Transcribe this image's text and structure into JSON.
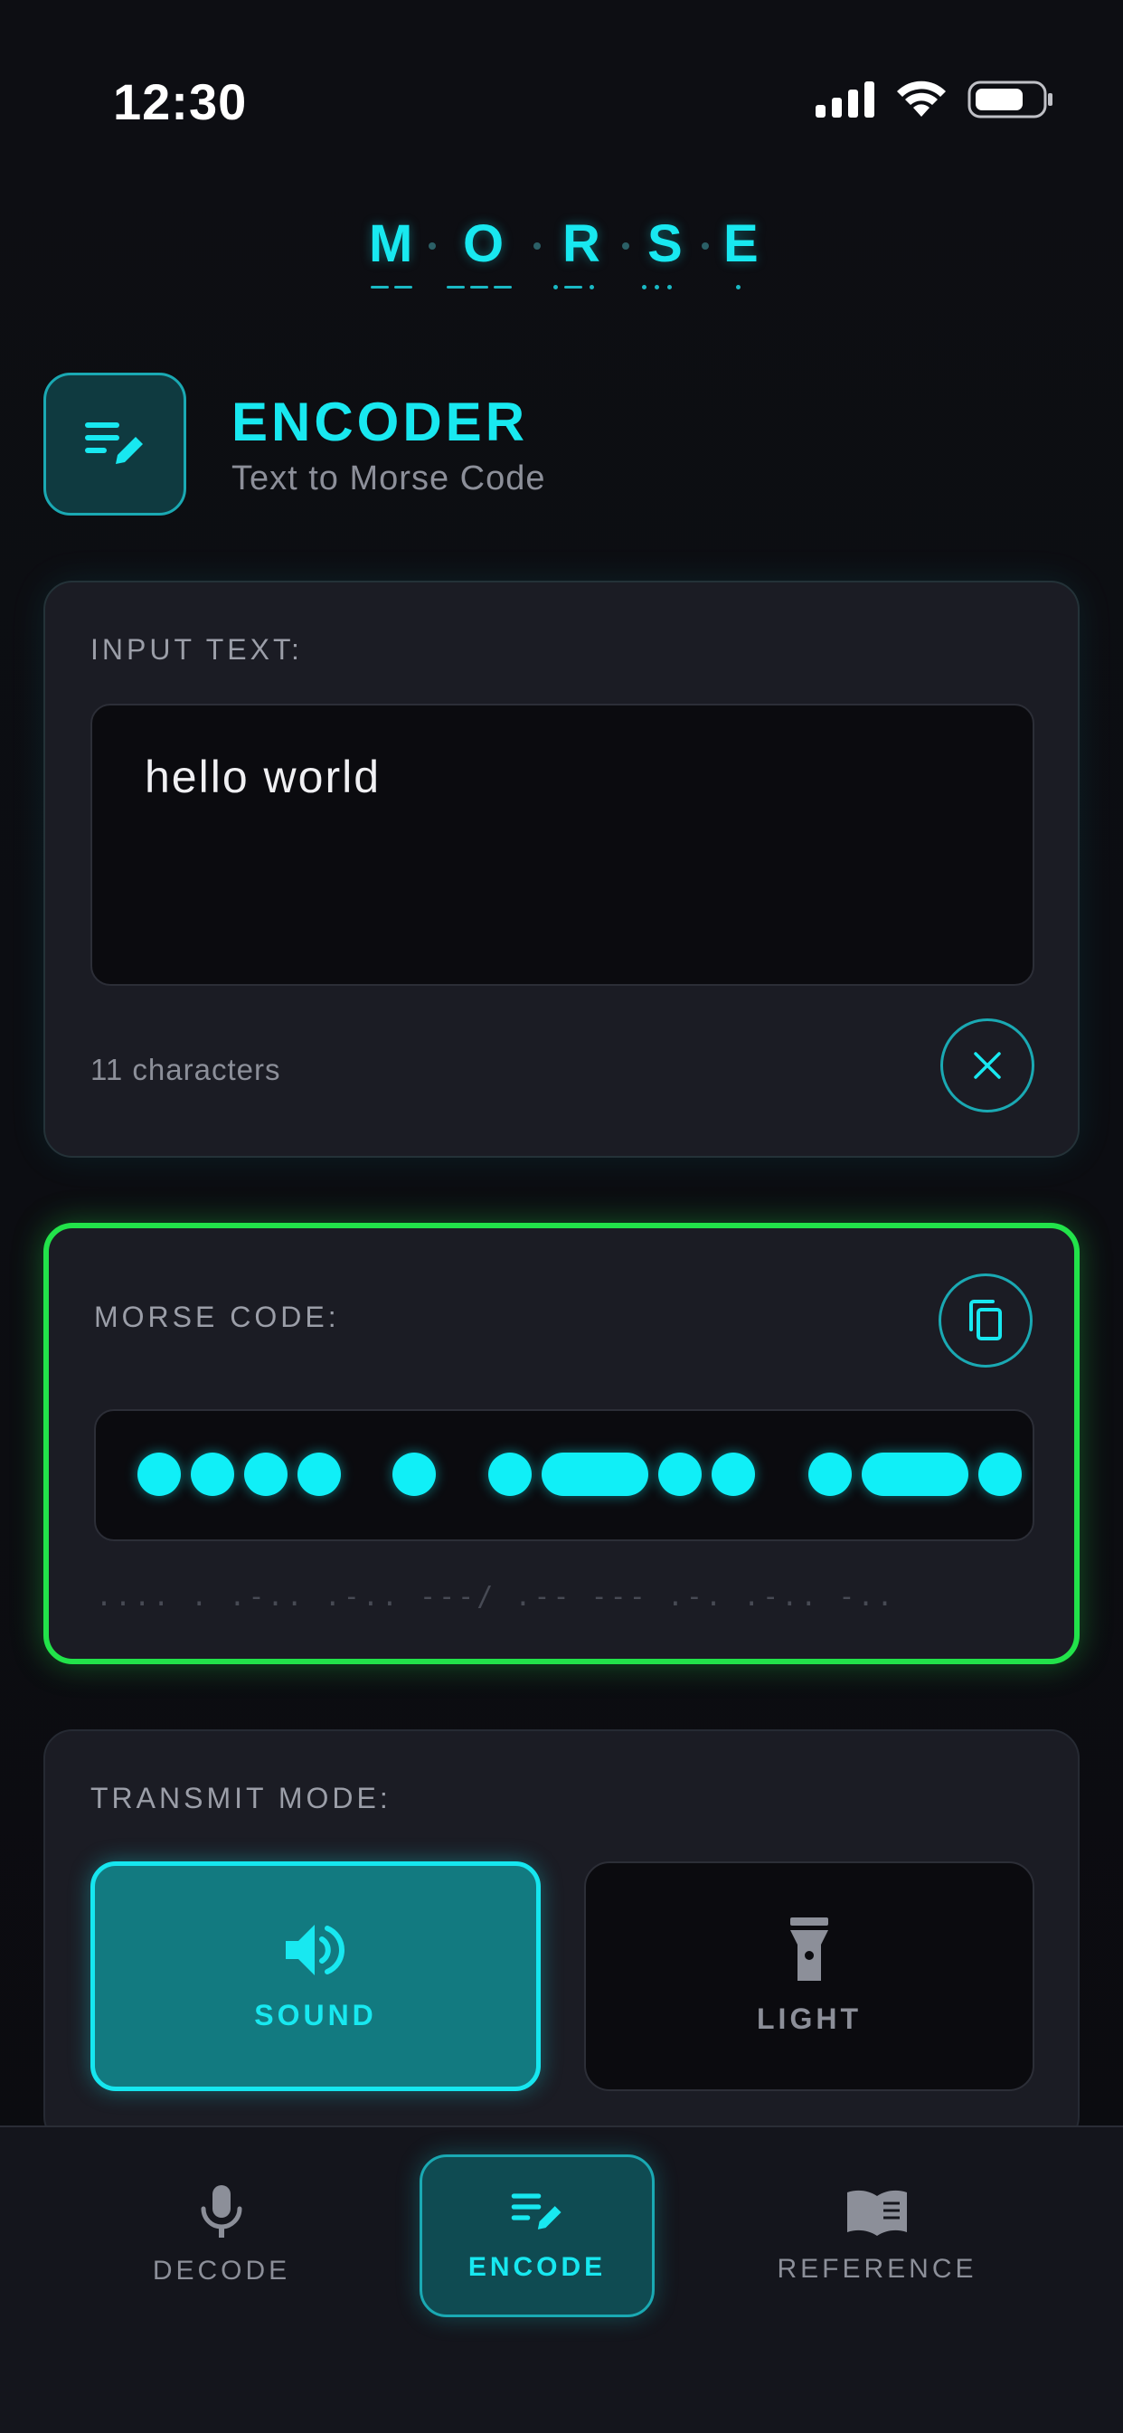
{
  "status_bar": {
    "time": "12:30"
  },
  "logo": {
    "letters": [
      "M",
      "O",
      "R",
      "S",
      "E"
    ]
  },
  "header": {
    "title": "ENCODER",
    "subtitle": "Text to Morse Code"
  },
  "input_card": {
    "label": "INPUT TEXT:",
    "value": "hello world",
    "char_count": "11 characters"
  },
  "morse_card": {
    "label": "MORSE CODE:",
    "code_text": ".... . .-.. .-.. ---/ .-- --- .-. .-.. -.."
  },
  "mode_card": {
    "label": "TRANSMIT MODE:",
    "sound_label": "SOUND",
    "light_label": "LIGHT",
    "selected": "SOUND"
  },
  "bottom_nav": {
    "decode": "DECODE",
    "encode": "ENCODE",
    "reference": "REFERENCE",
    "active": "ENCODE"
  },
  "colors": {
    "accent": "#18e8f0",
    "success_border": "#22e34a",
    "background": "#0c0d12",
    "card": "#1b1c24"
  },
  "icons": {
    "header": "edit-note-icon",
    "clear": "close-icon",
    "copy": "copy-icon",
    "sound": "speaker-icon",
    "light": "flashlight-icon",
    "decode": "microphone-icon",
    "encode": "edit-note-icon",
    "reference": "book-icon"
  }
}
